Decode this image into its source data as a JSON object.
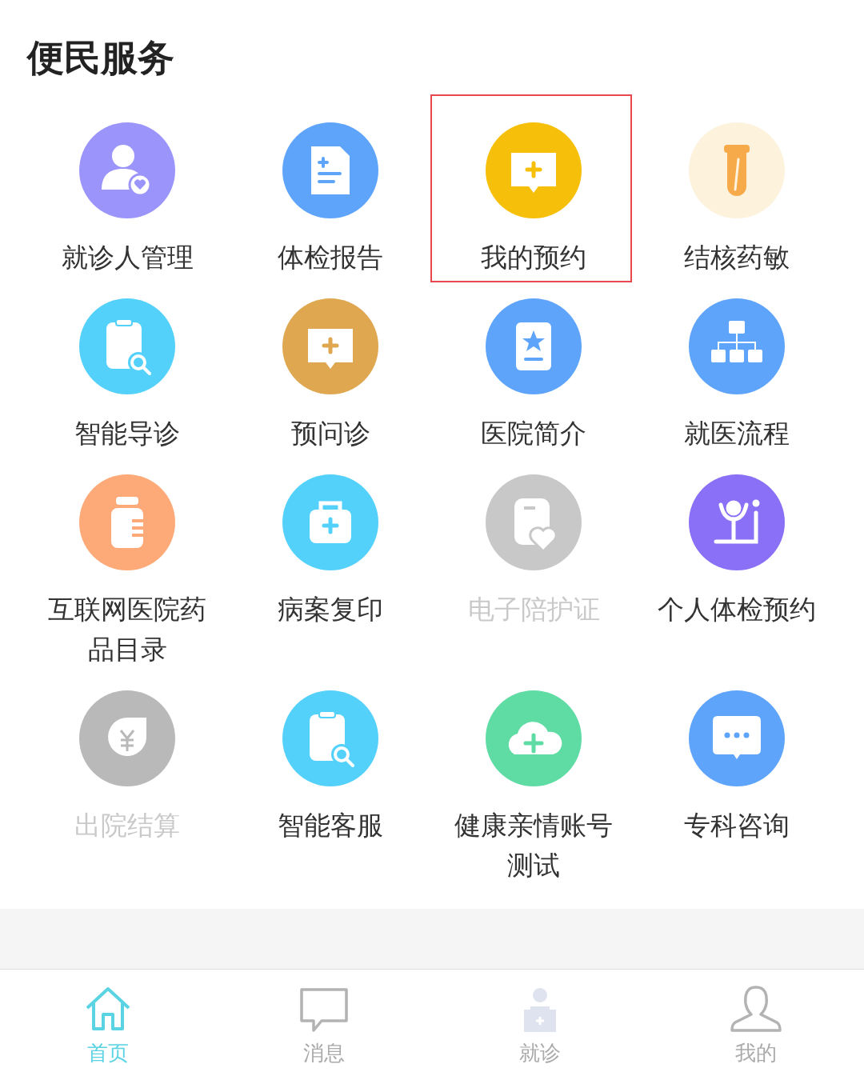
{
  "section_title": "便民服务",
  "services": [
    {
      "label": "就诊人管理",
      "kind": "person-heart",
      "color": "#9b95fb",
      "disabled": false,
      "highlighted": false
    },
    {
      "label": "体检报告",
      "kind": "document",
      "color": "#5ea4fb",
      "disabled": false,
      "highlighted": false
    },
    {
      "label": "我的预约",
      "kind": "chat-plus",
      "color": "#f6bf0a",
      "disabled": false,
      "highlighted": true
    },
    {
      "label": "结核药敏",
      "kind": "test-tube",
      "color": "#fdf2dc",
      "disabled": false,
      "highlighted": false
    },
    {
      "label": "智能导诊",
      "kind": "clipboard-search",
      "color": "#54d1fb",
      "disabled": false,
      "highlighted": false
    },
    {
      "label": "预问诊",
      "kind": "chat-plus",
      "color": "#dea750",
      "disabled": false,
      "highlighted": false
    },
    {
      "label": "医院简介",
      "kind": "book-star",
      "color": "#5ea4fb",
      "disabled": false,
      "highlighted": false
    },
    {
      "label": "就医流程",
      "kind": "org-chart",
      "color": "#5ea4fb",
      "disabled": false,
      "highlighted": false
    },
    {
      "label": "互联网医院药品目录",
      "kind": "medicine-bottle",
      "color": "#fdaa78",
      "disabled": false,
      "highlighted": false
    },
    {
      "label": "病案复印",
      "kind": "medical-kit",
      "color": "#54d1fb",
      "disabled": false,
      "highlighted": false
    },
    {
      "label": "电子陪护证",
      "kind": "clipboard-heart",
      "color": "#c8c8c8",
      "disabled": true,
      "highlighted": false
    },
    {
      "label": "个人体检预约",
      "kind": "exercise",
      "color": "#8a70f6",
      "disabled": false,
      "highlighted": false
    },
    {
      "label": "出院结算",
      "kind": "yen-leaf",
      "color": "#b9b9b9",
      "disabled": true,
      "highlighted": false
    },
    {
      "label": "智能客服",
      "kind": "clipboard-search",
      "color": "#54d1fb",
      "disabled": false,
      "highlighted": false
    },
    {
      "label": "健康亲情账号测试",
      "kind": "cloud-plus",
      "color": "#5fdca3",
      "disabled": false,
      "highlighted": false
    },
    {
      "label": "专科咨询",
      "kind": "chat-dots",
      "color": "#5ea4fb",
      "disabled": false,
      "highlighted": false
    }
  ],
  "tab_bar": [
    {
      "label": "首页",
      "kind": "home",
      "selected": true
    },
    {
      "label": "消息",
      "kind": "message",
      "selected": false
    },
    {
      "label": "就诊",
      "kind": "doctor",
      "selected": false
    },
    {
      "label": "我的",
      "kind": "user",
      "selected": false
    }
  ]
}
